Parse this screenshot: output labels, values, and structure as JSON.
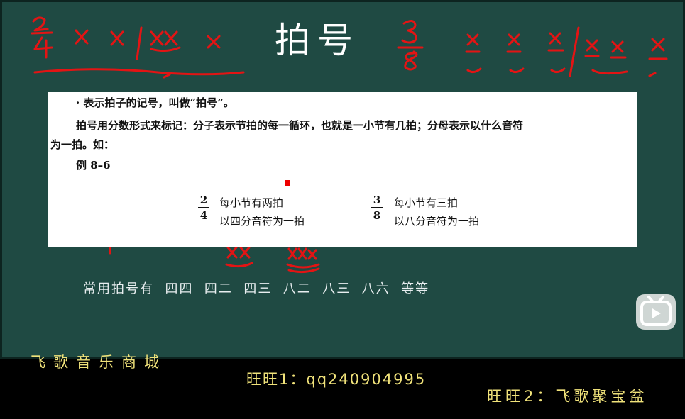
{
  "title": "拍号",
  "document": {
    "line1": "· 表示拍子的记号，叫做“拍号”。",
    "line2": "拍号用分数形式来标记：分子表示节拍的每一循环，也就是一小节有几拍；分母表示以什么音符",
    "line3": "为一拍。如：",
    "example_label": "例 8–6",
    "examples": [
      {
        "numerator": "2",
        "denominator": "4",
        "desc1": "每小节有两拍",
        "desc2": "以四分音符为一拍"
      },
      {
        "numerator": "3",
        "denominator": "8",
        "desc1": "每小节有三拍",
        "desc2": "以八分音符为一拍"
      }
    ]
  },
  "common_meters": "常用拍号有  四四  四二  四三  八二  八三  八六  等等",
  "footer": {
    "shop": "飞歌音乐商城",
    "wangwang1": "旺旺1：qq240904995",
    "wangwang2": "旺旺2：飞歌聚宝盆"
  },
  "annotations": {
    "top_left_meter": "2/4",
    "top_right_meter": "3/8",
    "left_meter": "2/4"
  },
  "colors": {
    "board": "#1f4a43",
    "annotation": "#e31414",
    "footer_text": "#f0e27a"
  },
  "icons": [
    "bilibili-tv-icon"
  ]
}
